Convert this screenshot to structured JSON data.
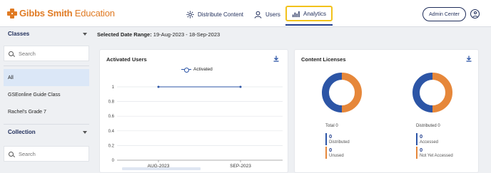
{
  "brand": {
    "bold": "Gibbs Smith",
    "light": " Education",
    "color": "#e07b24"
  },
  "nav": {
    "items": [
      {
        "label": "Distribute Content",
        "icon": "distribute-icon"
      },
      {
        "label": "Users",
        "icon": "user-icon"
      },
      {
        "label": "Analytics",
        "icon": "bar-chart-icon",
        "active": true
      }
    ],
    "admin_label": "Admin Center",
    "profile_icon": "profile-icon"
  },
  "sidebar": {
    "classes_header": "Classes",
    "classes_search_placeholder": "Search",
    "class_items": [
      {
        "label": "All",
        "active": true
      },
      {
        "label": "GSEonline Guide Class"
      },
      {
        "label": "Rachel's Grade 7"
      }
    ],
    "collection_header": "Collection",
    "collection_search_placeholder": "Search"
  },
  "date_range": {
    "label": "Selected Date Range:",
    "value": "19-Aug-2023 - 18-Sep-2023"
  },
  "activated_users": {
    "title": "Activated Users",
    "legend": "Activated"
  },
  "content_licenses": {
    "title": "Content Licenses",
    "left": {
      "caption": "Total 0",
      "stats": [
        {
          "value": "0",
          "label": "Distributed"
        },
        {
          "value": "0",
          "label": "Unused"
        }
      ]
    },
    "right": {
      "caption": "Distributed 0",
      "stats": [
        {
          "value": "0",
          "label": "Accessed"
        },
        {
          "value": "0",
          "label": "Not Yet Accessed"
        }
      ]
    }
  },
  "colors": {
    "blue": "#2c55a6",
    "orange": "#e6873a",
    "navy": "#1f2d5a",
    "highlight": "#f2c21b"
  },
  "chart_data": [
    {
      "type": "line",
      "title": "Activated Users",
      "categories": [
        "AUG-2023",
        "SEP-2023"
      ],
      "series": [
        {
          "name": "Activated",
          "values": [
            1,
            1
          ]
        }
      ],
      "yticks": [
        "1",
        "0.8",
        "0.6",
        "0.4",
        "0.2",
        "0"
      ],
      "ylim": [
        0,
        1
      ],
      "grid": true,
      "legend": "top-center"
    },
    {
      "type": "pie",
      "title": "Content Licenses",
      "charts": [
        {
          "caption": "Total 0",
          "slices": [
            {
              "label": "Distributed",
              "value": 50
            },
            {
              "label": "Unused",
              "value": 50
            }
          ]
        },
        {
          "caption": "Distributed 0",
          "slices": [
            {
              "label": "Accessed",
              "value": 50
            },
            {
              "label": "Not Yet Accessed",
              "value": 50
            }
          ]
        }
      ]
    }
  ]
}
